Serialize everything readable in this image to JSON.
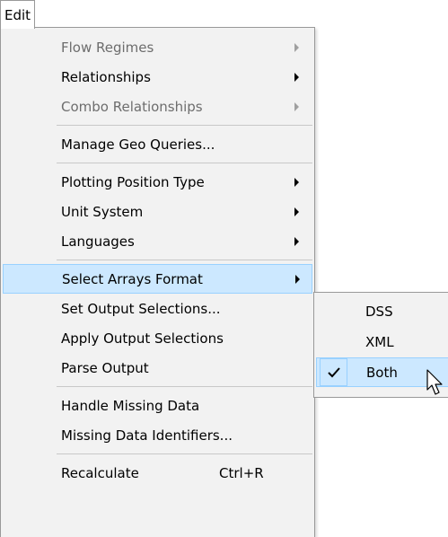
{
  "menubar": {
    "edit_label": "Edit"
  },
  "menu": {
    "flow_regimes": "Flow Regimes",
    "relationships": "Relationships",
    "combo_relationships": "Combo Relationships",
    "manage_geo_queries": "Manage Geo Queries...",
    "plotting_position_type": "Plotting Position Type",
    "unit_system": "Unit System",
    "languages": "Languages",
    "select_arrays_format": "Select Arrays Format",
    "set_output_selections": "Set Output Selections...",
    "apply_output_selections": "Apply Output Selections",
    "parse_output": "Parse Output",
    "handle_missing_data": "Handle Missing Data",
    "missing_data_identifiers": "Missing Data Identifiers...",
    "recalculate": "Recalculate",
    "recalculate_shortcut": "Ctrl+R"
  },
  "submenu": {
    "dss": "DSS",
    "xml": "XML",
    "both": "Both",
    "checked_item": "Both"
  },
  "icons": {
    "submenu_arrow": "triangle-right-icon",
    "check": "checkmark-icon",
    "cursor": "mouse-pointer-icon"
  },
  "colors": {
    "highlight_fill": "#cce8ff",
    "highlight_border": "#99d1ff",
    "menu_background": "#f2f2f2",
    "disabled_text": "#6d6d6d"
  }
}
